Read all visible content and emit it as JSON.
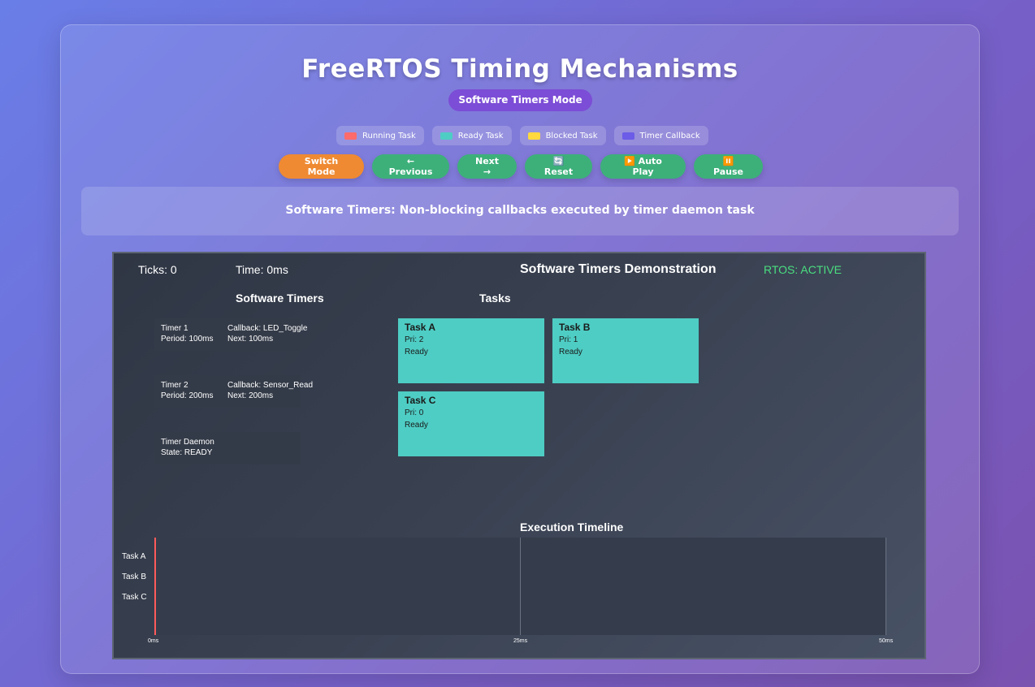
{
  "header": {
    "title": "FreeRTOS Timing Mechanisms",
    "mode_badge": "Software Timers Mode"
  },
  "legend": [
    {
      "label": "Running Task",
      "color": "#ff6b6b"
    },
    {
      "label": "Ready Task",
      "color": "#4ecdc4"
    },
    {
      "label": "Blocked Task",
      "color": "#ffd93d"
    },
    {
      "label": "Timer Callback",
      "color": "#6c5ce7"
    }
  ],
  "controls": {
    "switch_mode": "Switch Mode",
    "previous": "← Previous",
    "next": "Next →",
    "reset": "🔄 Reset",
    "auto_play": "▶️ Auto Play",
    "pause": "⏸️ Pause"
  },
  "description": "Software Timers: Non-blocking callbacks executed by timer daemon task",
  "sim": {
    "ticks": "Ticks: 0",
    "time": "Time: 0ms",
    "title": "Software Timers Demonstration",
    "status": "RTOS: ACTIVE",
    "status_color": "#4ade80",
    "timers_title": "Software Timers",
    "tasks_title": "Tasks",
    "timers": [
      {
        "name": "Timer 1",
        "period": "Period: 100ms",
        "callback": "Callback: LED_Toggle",
        "next": "Next: 100ms"
      },
      {
        "name": "Timer 2",
        "period": "Period: 200ms",
        "callback": "Callback: Sensor_Read",
        "next": "Next: 200ms"
      }
    ],
    "daemon": {
      "name": "Timer Daemon",
      "state": "State: READY"
    },
    "tasks": [
      {
        "name": "Task A",
        "pri": "Pri: 2",
        "state": "Ready"
      },
      {
        "name": "Task B",
        "pri": "Pri: 1",
        "state": "Ready"
      },
      {
        "name": "Task C",
        "pri": "Pri: 0",
        "state": "Ready"
      }
    ],
    "timeline": {
      "title": "Execution Timeline",
      "rows": [
        "Task A",
        "Task B",
        "Task C"
      ],
      "ticks": [
        "0ms",
        "25ms",
        "50ms"
      ],
      "cursor_ms": 0
    }
  }
}
